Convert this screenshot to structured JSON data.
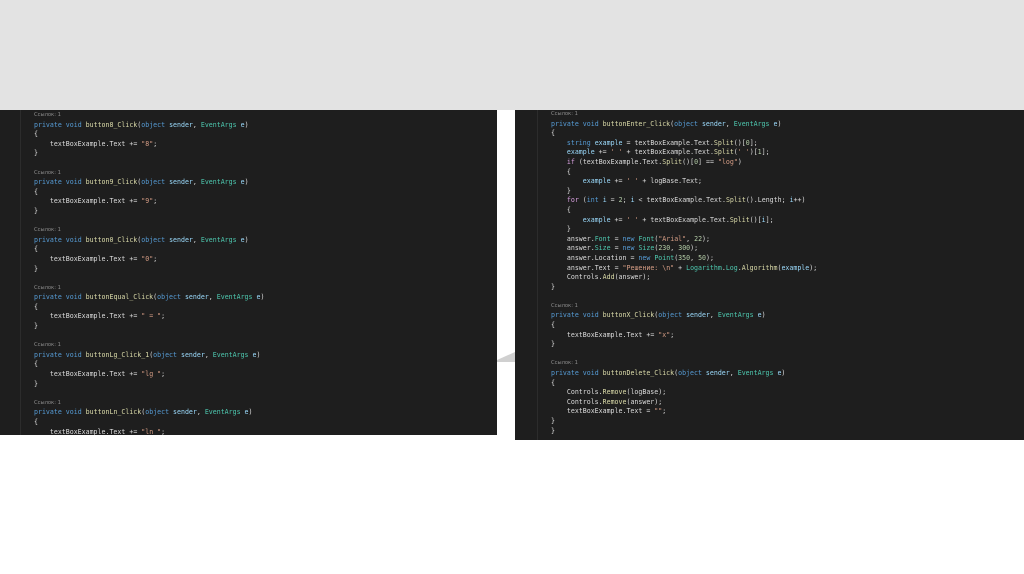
{
  "left_code": [
    "Ссылок: 1",
    "private void button8_Click(object sender, EventArgs e)",
    "{",
    "    textBoxExample.Text += \"8\";",
    "}",
    "",
    "Ссылок: 1",
    "private void button9_Click(object sender, EventArgs e)",
    "{",
    "    textBoxExample.Text += \"9\";",
    "}",
    "",
    "Ссылок: 1",
    "private void button0_Click(object sender, EventArgs e)",
    "{",
    "    textBoxExample.Text += \"0\";",
    "}",
    "",
    "Ссылок: 1",
    "private void buttonEqual_Click(object sender, EventArgs e)",
    "{",
    "    textBoxExample.Text += \" = \";",
    "}",
    "",
    "Ссылок: 1",
    "private void buttonLg_Click_1(object sender, EventArgs e)",
    "{",
    "    textBoxExample.Text += \"lg \";",
    "}",
    "",
    "Ссылок: 1",
    "private void buttonLn_Click(object sender, EventArgs e)",
    "{",
    "    textBoxExample.Text += \"ln \";",
    "}"
  ],
  "right_code": [
    "Ссылок: 1",
    "private void buttonEnter_Click(object sender, EventArgs e)",
    "{",
    "    string example = textBoxExample.Text.Split()[0];",
    "    example += ' ' + textBoxExample.Text.Split(' ')[1];",
    "    if (textBoxExample.Text.Split()[0] == \"log\")",
    "    {",
    "        example += ' ' + logBase.Text;",
    "    }",
    "    for (int i = 2; i < textBoxExample.Text.Split().Length; i++)",
    "    {",
    "        example += ' ' + textBoxExample.Text.Split()[i];",
    "    }",
    "    answer.Font = new Font(\"Arial\", 22);",
    "    answer.Size = new Size(230, 300);",
    "    answer.Location = new Point(350, 50);",
    "    answer.Text = \"Решение: \\n\" + Logarithm.Log.Algorithm(example);",
    "    Controls.Add(answer);",
    "}",
    "",
    "Ссылок: 1",
    "private void buttonX_Click(object sender, EventArgs e)",
    "{",
    "    textBoxExample.Text += \"x\";",
    "}",
    "",
    "Ссылок: 1",
    "private void buttonDelete_Click(object sender, EventArgs e)",
    "{",
    "    Controls.Remove(logBase);",
    "    Controls.Remove(answer);",
    "    textBoxExample.Text = \"\";",
    "}",
    "}"
  ],
  "colors": {
    "editor_bg": "#1e1e1e",
    "keyword": "#569cd6",
    "control_keyword": "#d8a0df",
    "method": "#dcdcaa",
    "type": "#4ec9b0",
    "parameter": "#9cdcfe",
    "string": "#d69d85",
    "number": "#b5cea8",
    "codelens": "#8d8d8d",
    "slide_top_band": "#e3e3e3"
  }
}
